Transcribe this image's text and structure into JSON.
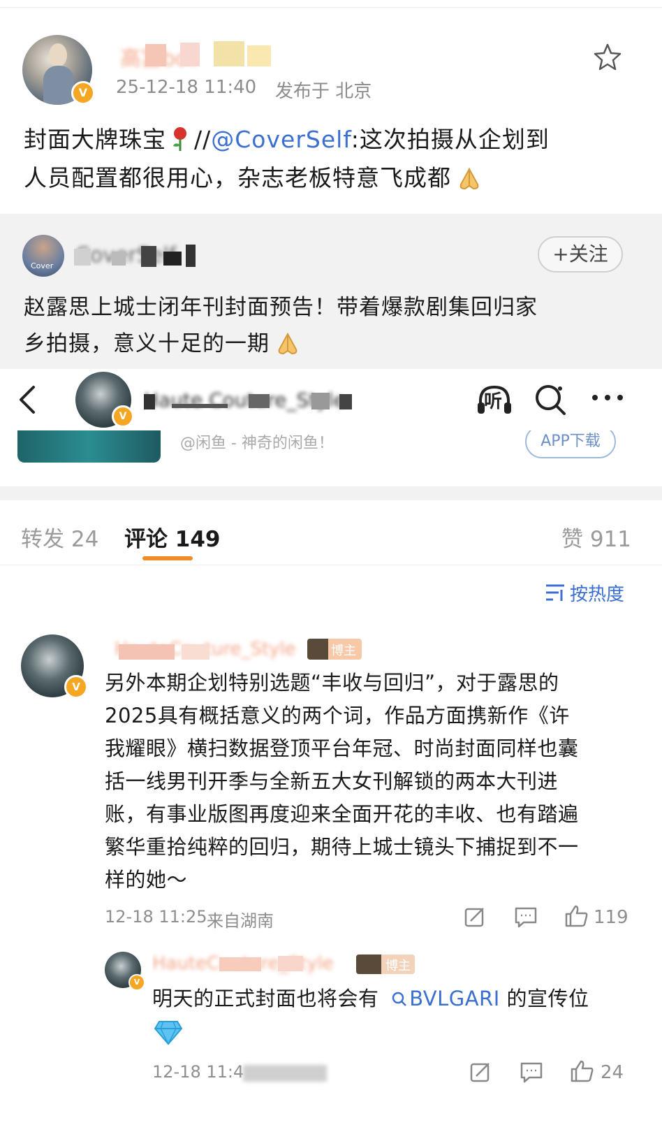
{
  "post": {
    "author_name": "高富bot",
    "timestamp": "25-12-18 11:40",
    "location": "发布于 北京",
    "body_part1": "封面大牌珠宝",
    "body_sep": "//",
    "mention": "@CoverSelf",
    "body_part2": ":这次拍摄从企划到",
    "body_line2": "人员配置都很用心，杂志老板特意飞成都"
  },
  "quoted": {
    "author_name": "CoverSelf",
    "avatar_label": "Cover",
    "follow_label": "+关注",
    "body_line1": "赵露思上城士闭年刊封面预告！带着爆款剧集回归家",
    "body_line2": "乡拍摄，意义十足的一期"
  },
  "topbar": {
    "username": "Haute Couture_Style",
    "listen_label": "听"
  },
  "ad": {
    "text": "@闲鱼 - 神奇的闲鱼！",
    "button_label": "APP下载"
  },
  "tabs": {
    "repost": "转发 24",
    "comment": "评论 149",
    "like": "赞 911",
    "sort": "按热度"
  },
  "comment1": {
    "author": "HauteCouture_Style",
    "badge": "博主",
    "text_lines": [
      "另外本期企划特别选题“丰收与回归”，对于露思的",
      "2025具有概括意义的两个词，作品方面携新作《许",
      "我耀眼》横扫数据登顶平台年冠、时尚封面同样也囊",
      "括一线男刊开季与全新五大女刊解锁的两本大刊进",
      "账，有事业版图再度迎来全面开花的丰收、也有踏遍",
      "繁华重拾纯粹的回归，期待上城士镜头下捕捉到不一",
      "样的她～"
    ],
    "time": "12-18 11:25",
    "from": "来自湖南",
    "likes": "119"
  },
  "reply1": {
    "author": "HauteCouture_Style",
    "badge": "博主",
    "text_pre": "明天的正式封面也将会有",
    "topic": "BVLGARI",
    "text_post": "的宣传位",
    "time": "12-18 11:4",
    "likes": "24"
  },
  "colors": {
    "accent": "#f5a623",
    "link": "#3b6fd1",
    "tab_underline": "#f08c26",
    "muted": "#8c8c8c"
  },
  "icons": [
    "star-icon",
    "rose-icon",
    "pray-icon",
    "back-icon",
    "listen-icon",
    "search-icon",
    "more-icon",
    "repost-icon",
    "comment-icon",
    "like-icon",
    "sort-icon",
    "search-topic-icon",
    "diamond-icon"
  ]
}
